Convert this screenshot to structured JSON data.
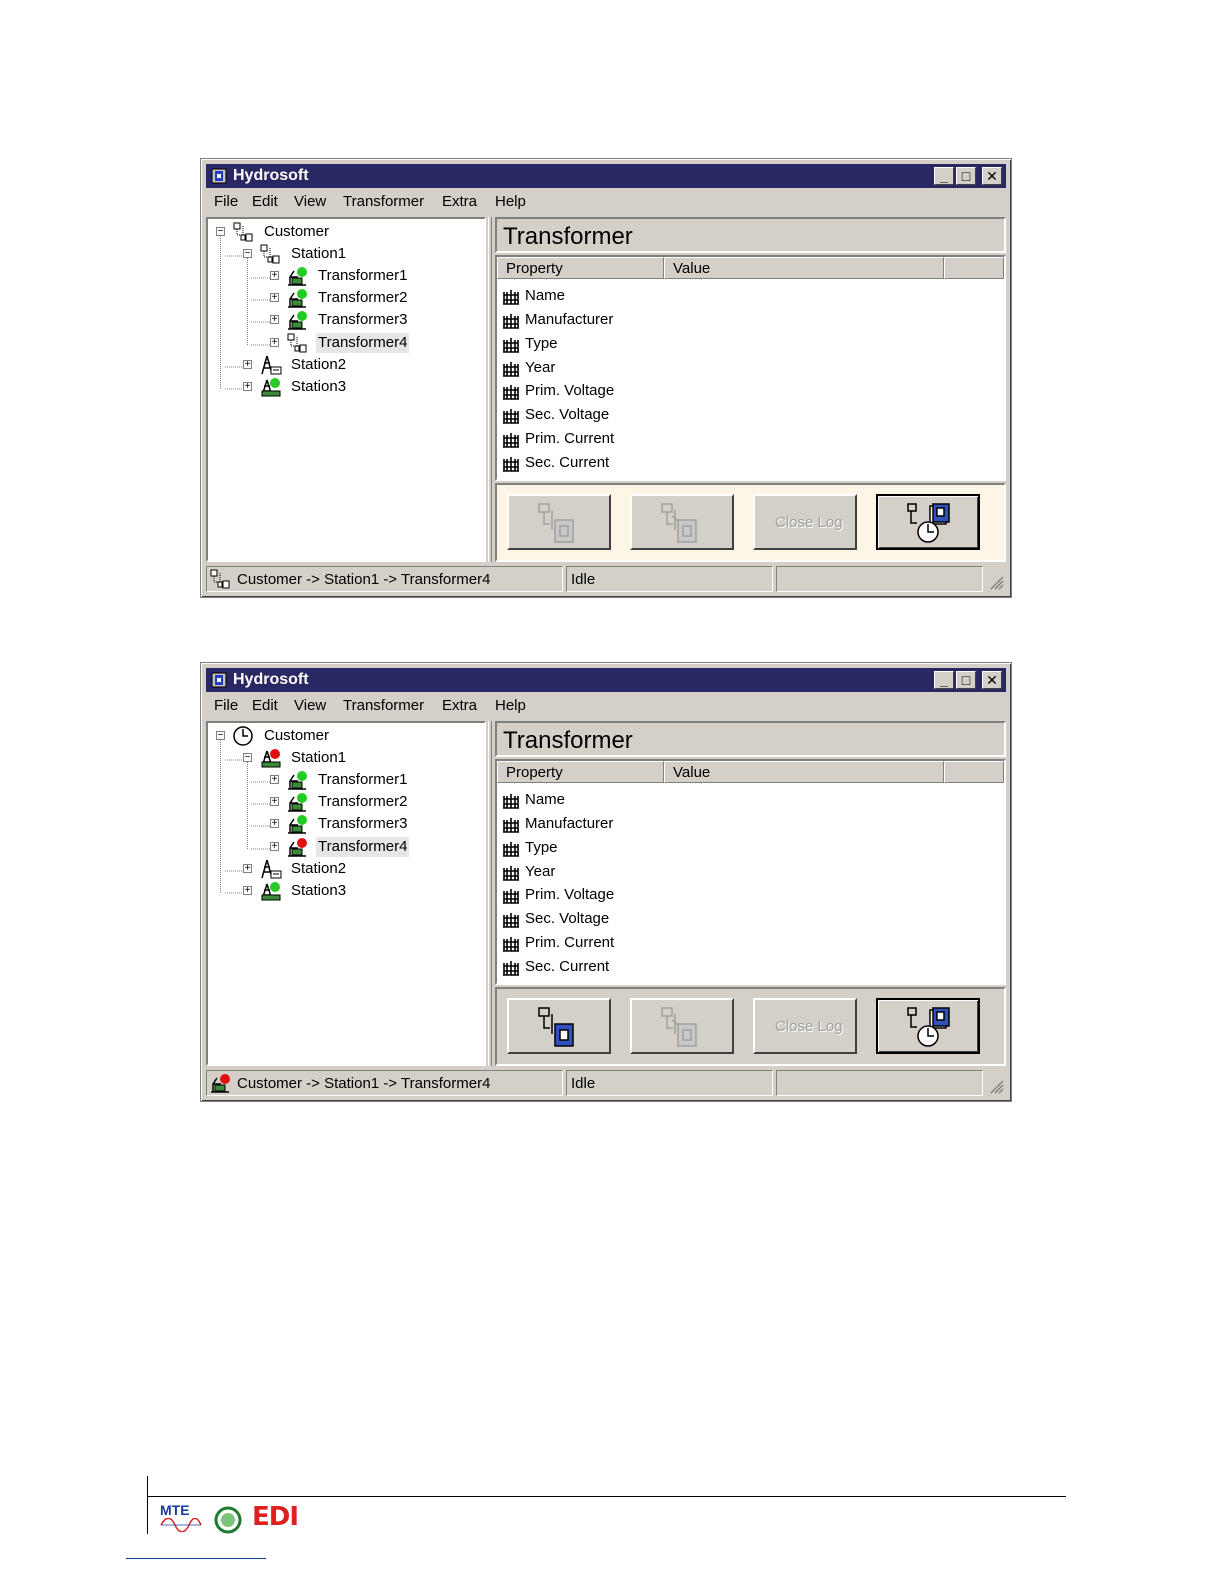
{
  "windows": [
    {
      "title": "Hydrosoft",
      "menu": [
        "File",
        "Edit",
        "View",
        "Transformer",
        "Extra",
        "Help"
      ],
      "tree": [
        {
          "label": "Customer",
          "expander": "−",
          "icon": "network-icon"
        },
        {
          "label": "Station1",
          "expander": "−",
          "icon": "network-icon"
        },
        {
          "label": "Transformer1",
          "expander": "+",
          "icon": "transformer-green-icon"
        },
        {
          "label": "Transformer2",
          "expander": "+",
          "icon": "transformer-green-icon"
        },
        {
          "label": "Transformer3",
          "expander": "+",
          "icon": "transformer-green-icon"
        },
        {
          "label": "Transformer4",
          "expander": "+",
          "icon": "network-icon",
          "selected": true
        },
        {
          "label": "Station2",
          "expander": "+",
          "icon": "station-icon"
        },
        {
          "label": "Station3",
          "expander": "+",
          "icon": "station-green-icon"
        }
      ],
      "panel_title": "Transformer",
      "columns": [
        "Property",
        "Value"
      ],
      "properties": [
        "Name",
        "Manufacturer",
        "Type",
        "Year",
        "Prim. Voltage",
        "Sec. Voltage",
        "Prim. Current",
        "Sec. Current"
      ],
      "buttons": {
        "close_log": "Close Log"
      },
      "status": {
        "path": "Customer -> Station1 -> Transformer4",
        "state": "Idle",
        "extra": ""
      }
    },
    {
      "title": "Hydrosoft",
      "menu": [
        "File",
        "Edit",
        "View",
        "Transformer",
        "Extra",
        "Help"
      ],
      "tree": [
        {
          "label": "Customer",
          "expander": "−",
          "icon": "clock-icon"
        },
        {
          "label": "Station1",
          "expander": "−",
          "icon": "station-red-icon"
        },
        {
          "label": "Transformer1",
          "expander": "+",
          "icon": "transformer-green-icon"
        },
        {
          "label": "Transformer2",
          "expander": "+",
          "icon": "transformer-green-icon"
        },
        {
          "label": "Transformer3",
          "expander": "+",
          "icon": "transformer-green-icon"
        },
        {
          "label": "Transformer4",
          "expander": "+",
          "icon": "transformer-red-icon",
          "selected": true
        },
        {
          "label": "Station2",
          "expander": "+",
          "icon": "station-icon"
        },
        {
          "label": "Station3",
          "expander": "+",
          "icon": "station-green-icon"
        }
      ],
      "panel_title": "Transformer",
      "columns": [
        "Property",
        "Value"
      ],
      "properties": [
        "Name",
        "Manufacturer",
        "Type",
        "Year",
        "Prim. Voltage",
        "Sec. Voltage",
        "Prim. Current",
        "Sec. Current"
      ],
      "buttons": {
        "close_log": "Close Log"
      },
      "status": {
        "path": "Customer -> Station1 -> Transformer4",
        "state": "Idle",
        "extra": ""
      }
    }
  ],
  "footer": {
    "logos": [
      "MTE",
      "EDI"
    ]
  },
  "colors": {
    "titlebar": "#292862",
    "window": "#d4d0c8",
    "status_green": "#22cc22",
    "status_red": "#e01010"
  }
}
